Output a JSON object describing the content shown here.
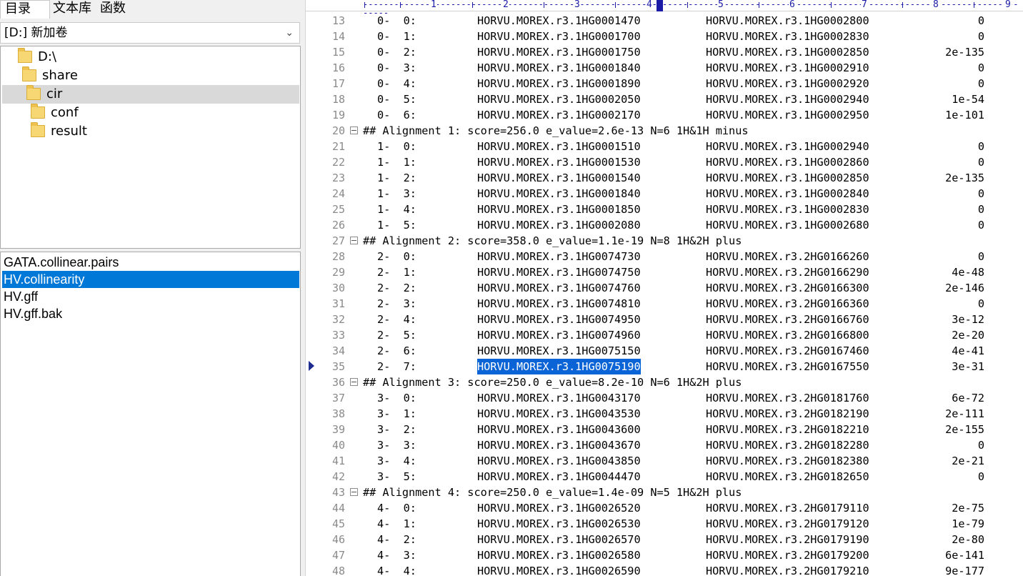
{
  "sidebar": {
    "tabs": [
      "目录",
      "文本库",
      "函数"
    ],
    "drive": "[D:] 新加卷",
    "tree": [
      {
        "label": "D:\\"
      },
      {
        "label": "share"
      },
      {
        "label": "cir"
      },
      {
        "label": "conf"
      },
      {
        "label": "result"
      }
    ],
    "files": [
      "GATA.collinear.pairs",
      "HV.collinearity",
      "HV.gff",
      "HV.gff.bak"
    ]
  },
  "ruler": {
    "numbers": [
      "1",
      "2",
      "3",
      "4",
      "5",
      "6",
      "7",
      "8",
      "9"
    ]
  },
  "editor": {
    "lines": [
      {
        "n": "13",
        "type": "row",
        "idx": "0-  0:",
        "g1": "HORVU.MOREX.r3.1HG0001470",
        "g2": "HORVU.MOREX.r3.1HG0002800",
        "e": "0"
      },
      {
        "n": "14",
        "type": "row",
        "idx": "0-  1:",
        "g1": "HORVU.MOREX.r3.1HG0001700",
        "g2": "HORVU.MOREX.r3.1HG0002830",
        "e": "0"
      },
      {
        "n": "15",
        "type": "row",
        "idx": "0-  2:",
        "g1": "HORVU.MOREX.r3.1HG0001750",
        "g2": "HORVU.MOREX.r3.1HG0002850",
        "e": "2e-135"
      },
      {
        "n": "16",
        "type": "row",
        "idx": "0-  3:",
        "g1": "HORVU.MOREX.r3.1HG0001840",
        "g2": "HORVU.MOREX.r3.1HG0002910",
        "e": "0"
      },
      {
        "n": "17",
        "type": "row",
        "idx": "0-  4:",
        "g1": "HORVU.MOREX.r3.1HG0001890",
        "g2": "HORVU.MOREX.r3.1HG0002920",
        "e": "0"
      },
      {
        "n": "18",
        "type": "row",
        "idx": "0-  5:",
        "g1": "HORVU.MOREX.r3.1HG0002050",
        "g2": "HORVU.MOREX.r3.1HG0002940",
        "e": "1e-54"
      },
      {
        "n": "19",
        "type": "row",
        "idx": "0-  6:",
        "g1": "HORVU.MOREX.r3.1HG0002170",
        "g2": "HORVU.MOREX.r3.1HG0002950",
        "e": "1e-101"
      },
      {
        "n": "20",
        "type": "header",
        "text": "## Alignment 1: score=256.0 e_value=2.6e-13 N=6 1H&1H minus"
      },
      {
        "n": "21",
        "type": "row",
        "idx": "1-  0:",
        "g1": "HORVU.MOREX.r3.1HG0001510",
        "g2": "HORVU.MOREX.r3.1HG0002940",
        "e": "0"
      },
      {
        "n": "22",
        "type": "row",
        "idx": "1-  1:",
        "g1": "HORVU.MOREX.r3.1HG0001530",
        "g2": "HORVU.MOREX.r3.1HG0002860",
        "e": "0"
      },
      {
        "n": "23",
        "type": "row",
        "idx": "1-  2:",
        "g1": "HORVU.MOREX.r3.1HG0001540",
        "g2": "HORVU.MOREX.r3.1HG0002850",
        "e": "2e-135"
      },
      {
        "n": "24",
        "type": "row",
        "idx": "1-  3:",
        "g1": "HORVU.MOREX.r3.1HG0001840",
        "g2": "HORVU.MOREX.r3.1HG0002840",
        "e": "0"
      },
      {
        "n": "25",
        "type": "row",
        "idx": "1-  4:",
        "g1": "HORVU.MOREX.r3.1HG0001850",
        "g2": "HORVU.MOREX.r3.1HG0002830",
        "e": "0"
      },
      {
        "n": "26",
        "type": "row",
        "idx": "1-  5:",
        "g1": "HORVU.MOREX.r3.1HG0002080",
        "g2": "HORVU.MOREX.r3.1HG0002680",
        "e": "0"
      },
      {
        "n": "27",
        "type": "header",
        "text": "## Alignment 2: score=358.0 e_value=1.1e-19 N=8 1H&2H plus"
      },
      {
        "n": "28",
        "type": "row",
        "idx": "2-  0:",
        "g1": "HORVU.MOREX.r3.1HG0074730",
        "g2": "HORVU.MOREX.r3.2HG0166260",
        "e": "0"
      },
      {
        "n": "29",
        "type": "row",
        "idx": "2-  1:",
        "g1": "HORVU.MOREX.r3.1HG0074750",
        "g2": "HORVU.MOREX.r3.2HG0166290",
        "e": "4e-48"
      },
      {
        "n": "30",
        "type": "row",
        "idx": "2-  2:",
        "g1": "HORVU.MOREX.r3.1HG0074760",
        "g2": "HORVU.MOREX.r3.2HG0166300",
        "e": "2e-146"
      },
      {
        "n": "31",
        "type": "row",
        "idx": "2-  3:",
        "g1": "HORVU.MOREX.r3.1HG0074810",
        "g2": "HORVU.MOREX.r3.2HG0166360",
        "e": "0"
      },
      {
        "n": "32",
        "type": "row",
        "idx": "2-  4:",
        "g1": "HORVU.MOREX.r3.1HG0074950",
        "g2": "HORVU.MOREX.r3.2HG0166760",
        "e": "3e-12"
      },
      {
        "n": "33",
        "type": "row",
        "idx": "2-  5:",
        "g1": "HORVU.MOREX.r3.1HG0074960",
        "g2": "HORVU.MOREX.r3.2HG0166800",
        "e": "2e-20"
      },
      {
        "n": "34",
        "type": "row",
        "idx": "2-  6:",
        "g1": "HORVU.MOREX.r3.1HG0075150",
        "g2": "HORVU.MOREX.r3.2HG0167460",
        "e": "4e-41"
      },
      {
        "n": "35",
        "type": "row",
        "idx": "2-  7:",
        "g1": "HORVU.MOREX.r3.1HG0075190",
        "g2": "HORVU.MOREX.r3.2HG0167550",
        "e": "3e-31",
        "selected": true
      },
      {
        "n": "36",
        "type": "header",
        "text": "## Alignment 3: score=250.0 e_value=8.2e-10 N=6 1H&2H plus"
      },
      {
        "n": "37",
        "type": "row",
        "idx": "3-  0:",
        "g1": "HORVU.MOREX.r3.1HG0043170",
        "g2": "HORVU.MOREX.r3.2HG0181760",
        "e": "6e-72"
      },
      {
        "n": "38",
        "type": "row",
        "idx": "3-  1:",
        "g1": "HORVU.MOREX.r3.1HG0043530",
        "g2": "HORVU.MOREX.r3.2HG0182190",
        "e": "2e-111"
      },
      {
        "n": "39",
        "type": "row",
        "idx": "3-  2:",
        "g1": "HORVU.MOREX.r3.1HG0043600",
        "g2": "HORVU.MOREX.r3.2HG0182210",
        "e": "2e-155"
      },
      {
        "n": "40",
        "type": "row",
        "idx": "3-  3:",
        "g1": "HORVU.MOREX.r3.1HG0043670",
        "g2": "HORVU.MOREX.r3.2HG0182280",
        "e": "0"
      },
      {
        "n": "41",
        "type": "row",
        "idx": "3-  4:",
        "g1": "HORVU.MOREX.r3.1HG0043850",
        "g2": "HORVU.MOREX.r3.2HG0182380",
        "e": "2e-21"
      },
      {
        "n": "42",
        "type": "row",
        "idx": "3-  5:",
        "g1": "HORVU.MOREX.r3.1HG0044470",
        "g2": "HORVU.MOREX.r3.2HG0182650",
        "e": "0"
      },
      {
        "n": "43",
        "type": "header",
        "text": "## Alignment 4: score=250.0 e_value=1.4e-09 N=5 1H&2H plus"
      },
      {
        "n": "44",
        "type": "row",
        "idx": "4-  0:",
        "g1": "HORVU.MOREX.r3.1HG0026520",
        "g2": "HORVU.MOREX.r3.2HG0179110",
        "e": "2e-75"
      },
      {
        "n": "45",
        "type": "row",
        "idx": "4-  1:",
        "g1": "HORVU.MOREX.r3.1HG0026530",
        "g2": "HORVU.MOREX.r3.2HG0179120",
        "e": "1e-79"
      },
      {
        "n": "46",
        "type": "row",
        "idx": "4-  2:",
        "g1": "HORVU.MOREX.r3.1HG0026570",
        "g2": "HORVU.MOREX.r3.2HG0179190",
        "e": "2e-80"
      },
      {
        "n": "47",
        "type": "row",
        "idx": "4-  3:",
        "g1": "HORVU.MOREX.r3.1HG0026580",
        "g2": "HORVU.MOREX.r3.2HG0179200",
        "e": "6e-141"
      },
      {
        "n": "48",
        "type": "row",
        "idx": "4-  4:",
        "g1": "HORVU.MOREX.r3.1HG0026590",
        "g2": "HORVU.MOREX.r3.2HG0179210",
        "e": "9e-177"
      }
    ]
  },
  "colors": {
    "selection": "#0078d7",
    "ruler": "#1a1aa6",
    "line_numbers": "#8a8a8a"
  }
}
